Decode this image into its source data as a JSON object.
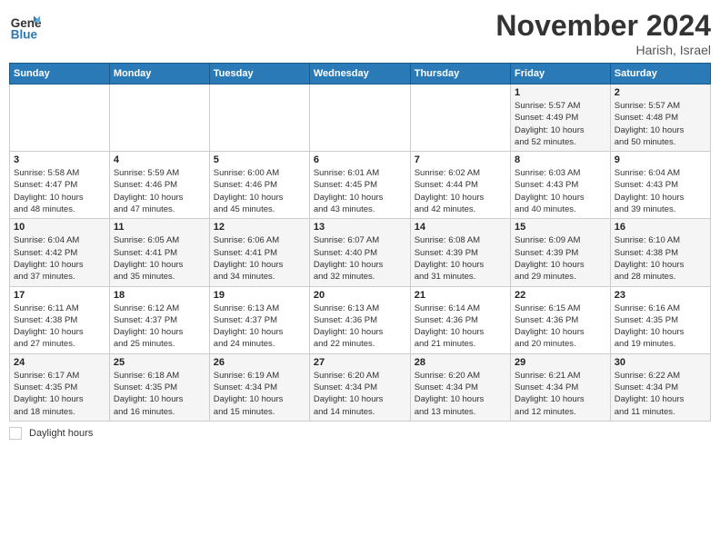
{
  "header": {
    "logo_line1": "General",
    "logo_line2": "Blue",
    "month": "November 2024",
    "location": "Harish, Israel"
  },
  "weekdays": [
    "Sunday",
    "Monday",
    "Tuesday",
    "Wednesday",
    "Thursday",
    "Friday",
    "Saturday"
  ],
  "weeks": [
    [
      {
        "day": "",
        "info": ""
      },
      {
        "day": "",
        "info": ""
      },
      {
        "day": "",
        "info": ""
      },
      {
        "day": "",
        "info": ""
      },
      {
        "day": "",
        "info": ""
      },
      {
        "day": "1",
        "info": "Sunrise: 5:57 AM\nSunset: 4:49 PM\nDaylight: 10 hours\nand 52 minutes."
      },
      {
        "day": "2",
        "info": "Sunrise: 5:57 AM\nSunset: 4:48 PM\nDaylight: 10 hours\nand 50 minutes."
      }
    ],
    [
      {
        "day": "3",
        "info": "Sunrise: 5:58 AM\nSunset: 4:47 PM\nDaylight: 10 hours\nand 48 minutes."
      },
      {
        "day": "4",
        "info": "Sunrise: 5:59 AM\nSunset: 4:46 PM\nDaylight: 10 hours\nand 47 minutes."
      },
      {
        "day": "5",
        "info": "Sunrise: 6:00 AM\nSunset: 4:46 PM\nDaylight: 10 hours\nand 45 minutes."
      },
      {
        "day": "6",
        "info": "Sunrise: 6:01 AM\nSunset: 4:45 PM\nDaylight: 10 hours\nand 43 minutes."
      },
      {
        "day": "7",
        "info": "Sunrise: 6:02 AM\nSunset: 4:44 PM\nDaylight: 10 hours\nand 42 minutes."
      },
      {
        "day": "8",
        "info": "Sunrise: 6:03 AM\nSunset: 4:43 PM\nDaylight: 10 hours\nand 40 minutes."
      },
      {
        "day": "9",
        "info": "Sunrise: 6:04 AM\nSunset: 4:43 PM\nDaylight: 10 hours\nand 39 minutes."
      }
    ],
    [
      {
        "day": "10",
        "info": "Sunrise: 6:04 AM\nSunset: 4:42 PM\nDaylight: 10 hours\nand 37 minutes."
      },
      {
        "day": "11",
        "info": "Sunrise: 6:05 AM\nSunset: 4:41 PM\nDaylight: 10 hours\nand 35 minutes."
      },
      {
        "day": "12",
        "info": "Sunrise: 6:06 AM\nSunset: 4:41 PM\nDaylight: 10 hours\nand 34 minutes."
      },
      {
        "day": "13",
        "info": "Sunrise: 6:07 AM\nSunset: 4:40 PM\nDaylight: 10 hours\nand 32 minutes."
      },
      {
        "day": "14",
        "info": "Sunrise: 6:08 AM\nSunset: 4:39 PM\nDaylight: 10 hours\nand 31 minutes."
      },
      {
        "day": "15",
        "info": "Sunrise: 6:09 AM\nSunset: 4:39 PM\nDaylight: 10 hours\nand 29 minutes."
      },
      {
        "day": "16",
        "info": "Sunrise: 6:10 AM\nSunset: 4:38 PM\nDaylight: 10 hours\nand 28 minutes."
      }
    ],
    [
      {
        "day": "17",
        "info": "Sunrise: 6:11 AM\nSunset: 4:38 PM\nDaylight: 10 hours\nand 27 minutes."
      },
      {
        "day": "18",
        "info": "Sunrise: 6:12 AM\nSunset: 4:37 PM\nDaylight: 10 hours\nand 25 minutes."
      },
      {
        "day": "19",
        "info": "Sunrise: 6:13 AM\nSunset: 4:37 PM\nDaylight: 10 hours\nand 24 minutes."
      },
      {
        "day": "20",
        "info": "Sunrise: 6:13 AM\nSunset: 4:36 PM\nDaylight: 10 hours\nand 22 minutes."
      },
      {
        "day": "21",
        "info": "Sunrise: 6:14 AM\nSunset: 4:36 PM\nDaylight: 10 hours\nand 21 minutes."
      },
      {
        "day": "22",
        "info": "Sunrise: 6:15 AM\nSunset: 4:36 PM\nDaylight: 10 hours\nand 20 minutes."
      },
      {
        "day": "23",
        "info": "Sunrise: 6:16 AM\nSunset: 4:35 PM\nDaylight: 10 hours\nand 19 minutes."
      }
    ],
    [
      {
        "day": "24",
        "info": "Sunrise: 6:17 AM\nSunset: 4:35 PM\nDaylight: 10 hours\nand 18 minutes."
      },
      {
        "day": "25",
        "info": "Sunrise: 6:18 AM\nSunset: 4:35 PM\nDaylight: 10 hours\nand 16 minutes."
      },
      {
        "day": "26",
        "info": "Sunrise: 6:19 AM\nSunset: 4:34 PM\nDaylight: 10 hours\nand 15 minutes."
      },
      {
        "day": "27",
        "info": "Sunrise: 6:20 AM\nSunset: 4:34 PM\nDaylight: 10 hours\nand 14 minutes."
      },
      {
        "day": "28",
        "info": "Sunrise: 6:20 AM\nSunset: 4:34 PM\nDaylight: 10 hours\nand 13 minutes."
      },
      {
        "day": "29",
        "info": "Sunrise: 6:21 AM\nSunset: 4:34 PM\nDaylight: 10 hours\nand 12 minutes."
      },
      {
        "day": "30",
        "info": "Sunrise: 6:22 AM\nSunset: 4:34 PM\nDaylight: 10 hours\nand 11 minutes."
      }
    ]
  ],
  "footer": {
    "legend_label": "Daylight hours"
  }
}
